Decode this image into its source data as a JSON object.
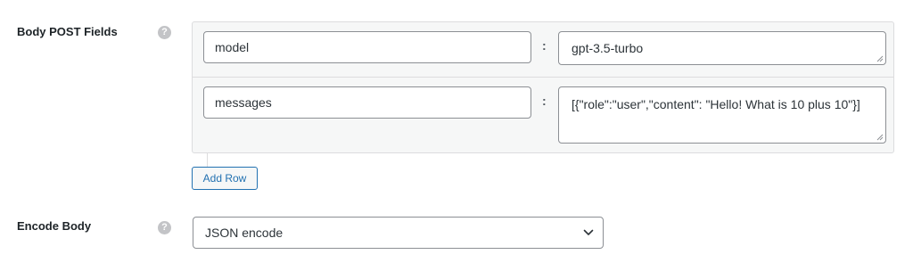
{
  "body_post_fields": {
    "label": "Body POST Fields",
    "help_icon": "question-circle-icon",
    "rows": [
      {
        "key": "model",
        "separator": ":",
        "value": "gpt-3.5-turbo"
      },
      {
        "key": "messages",
        "separator": ":",
        "value": "[{\"role\":\"user\",\"content\": \"Hello! What is 10 plus 10\"}]"
      }
    ],
    "add_row_label": "Add Row"
  },
  "encode_body": {
    "label": "Encode Body",
    "help_icon": "question-circle-icon",
    "selected": "JSON encode",
    "dropdown_icon": "chevron-down-icon"
  },
  "colors": {
    "accent": "#2271b1",
    "border": "#8c8f94",
    "help_icon": "#c3c4c7"
  }
}
